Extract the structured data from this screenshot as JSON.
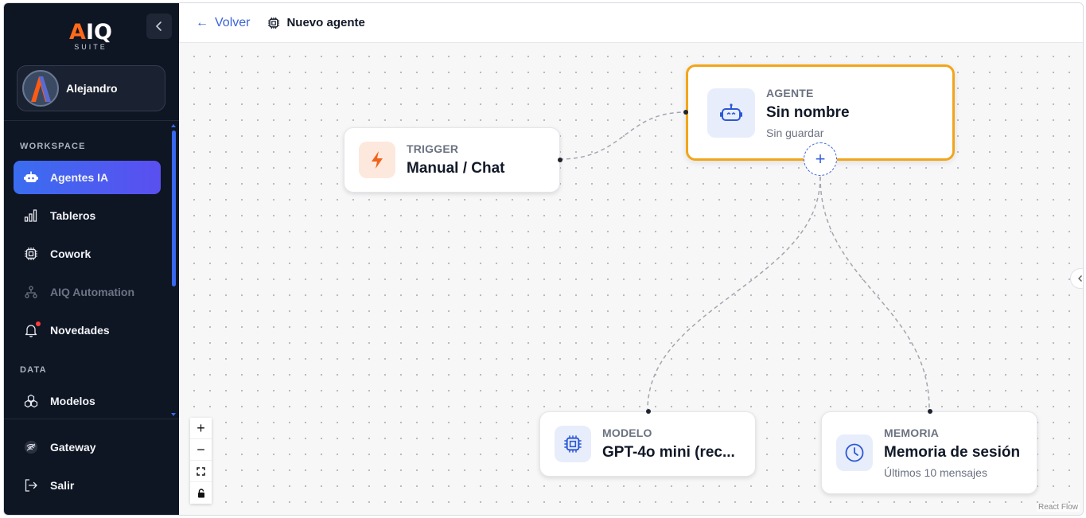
{
  "app": {
    "logo_text_a": "A",
    "logo_text_rest": "IQ",
    "logo_sub": "SUITE"
  },
  "user": {
    "name": "Alejandro"
  },
  "sidebar": {
    "workspace_label": "WORKSPACE",
    "data_label": "DATA",
    "items": [
      {
        "label": "Agentes IA",
        "icon": "robot-icon",
        "active": true
      },
      {
        "label": "Tableros",
        "icon": "bar-chart-icon"
      },
      {
        "label": "Cowork",
        "icon": "chip-icon"
      },
      {
        "label": "AIQ Automation",
        "icon": "workflow-icon",
        "disabled": true
      },
      {
        "label": "Novedades",
        "icon": "bell-icon",
        "badge": true
      },
      {
        "label": "Modelos",
        "icon": "cubes-icon"
      }
    ],
    "footer": [
      {
        "label": "Gateway",
        "icon": "gateway-icon"
      },
      {
        "label": "Salir",
        "icon": "logout-icon"
      }
    ]
  },
  "header": {
    "back_label": "Volver",
    "title": "Nuevo agente"
  },
  "nodes": {
    "trigger": {
      "kind": "TRIGGER",
      "title": "Manual / Chat"
    },
    "agent": {
      "kind": "AGENTE",
      "title": "Sin nombre",
      "subtitle": "Sin guardar"
    },
    "model": {
      "kind": "MODELO",
      "title": "GPT-4o mini (rec..."
    },
    "memory": {
      "kind": "MEMORIA",
      "title": "Memoria de sesión",
      "subtitle": "Últimos 10 mensajes"
    }
  },
  "controls": {
    "zoom_in": "+",
    "zoom_out": "−"
  },
  "attribution": "React Flow",
  "colors": {
    "sidebar_bg": "#0e1523",
    "accent": "#3a6df0",
    "selected_border": "#f2a51a",
    "trigger_accent": "#f0631c"
  }
}
